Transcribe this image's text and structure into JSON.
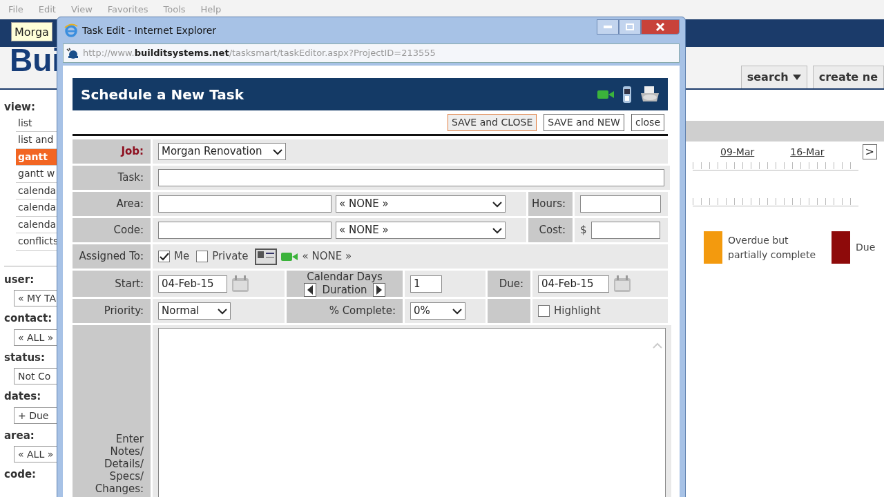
{
  "browser_menu": [
    "File",
    "Edit",
    "View",
    "Favorites",
    "Tools",
    "Help"
  ],
  "background_page": {
    "job_field": "Morga",
    "logo": "Bui",
    "sidebar": {
      "view_label": "view:",
      "view_items": [
        {
          "label": "list",
          "selected": false
        },
        {
          "label": "list and",
          "selected": false
        },
        {
          "label": "gantt",
          "selected": true
        },
        {
          "label": "gantt w",
          "selected": false
        },
        {
          "label": "calenda",
          "selected": false
        },
        {
          "label": "calenda",
          "selected": false
        },
        {
          "label": "calenda",
          "selected": false
        },
        {
          "label": "conflicts",
          "selected": false
        }
      ],
      "filters": [
        {
          "label": "user:",
          "value": "« MY TA"
        },
        {
          "label": "contact:",
          "value": "« ALL »"
        },
        {
          "label": "status:",
          "value": "Not Co"
        },
        {
          "label": "dates:",
          "value": "+ Due"
        },
        {
          "label": "area:",
          "value": "« ALL »"
        },
        {
          "label": "code:"
        }
      ]
    },
    "top_buttons": [
      {
        "label": "search",
        "kind": "dropdown"
      },
      {
        "label": "create ne",
        "kind": "plain"
      }
    ],
    "timeline": {
      "dates": [
        "09-Mar",
        "16-Mar"
      ],
      "next": ">"
    },
    "legend": [
      {
        "label": "Overdue but partially complete",
        "color": "#f39a0e"
      },
      {
        "label": "Due",
        "color": "#8e0a0a"
      }
    ]
  },
  "popup": {
    "title": "Task Edit - Internet Explorer",
    "url": "http://www.**builditsystems.net**/tasksmart/taskEditor.aspx?ProjectID=213555",
    "heading": "Schedule a New Task",
    "buttons": [
      {
        "label": "SAVE and CLOSE",
        "focused": true
      },
      {
        "label": "SAVE and NEW",
        "focused": false
      },
      {
        "label": "close",
        "focused": false
      }
    ],
    "job": {
      "label": "Job:",
      "value": "Morgan Renovation"
    },
    "task": {
      "label": "Task:"
    },
    "area": {
      "label": "Area:",
      "select": "« NONE »",
      "side_label": "Hours:"
    },
    "code": {
      "label": "Code:",
      "select": "« NONE »",
      "side_label": "Cost:",
      "currency": "$"
    },
    "assigned": {
      "label": "Assigned To:",
      "options": [
        {
          "label": "Me",
          "checked": true
        },
        {
          "label": "Private",
          "checked": false
        }
      ],
      "assignee": "« NONE »"
    },
    "start": {
      "label": "Start:",
      "value": "04-Feb-15"
    },
    "duration": {
      "unit": "Calendar Days",
      "label": "Duration",
      "value": "1"
    },
    "due": {
      "label": "Due:",
      "value": "04-Feb-15"
    },
    "priority": {
      "label": "Priority:",
      "value": "Normal"
    },
    "complete": {
      "label": "% Complete:",
      "value": "0%"
    },
    "highlight": {
      "label": "Highlight",
      "checked": false
    },
    "notes": {
      "label": "Enter Notes/ Details/ Specs/ Changes:"
    }
  }
}
